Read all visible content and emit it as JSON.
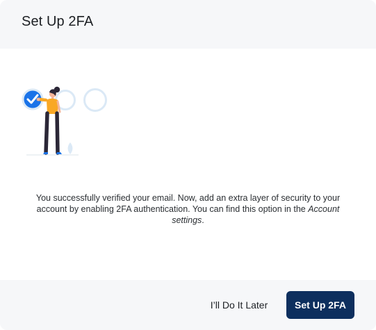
{
  "dialog": {
    "title": "Set Up 2FA",
    "message_prefix": "You successfully verified your email. Now, add an extra layer of security to your account by enabling 2FA authentication. You can find this option in the ",
    "message_link": "Account settings",
    "message_suffix": "."
  },
  "illustration": {
    "icon": "woman-checking-progress-steps-illustration",
    "steps_total": 3,
    "steps_completed": 1
  },
  "buttons": {
    "later_label": "I’ll Do It Later",
    "setup_label": "Set Up 2FA"
  },
  "colors": {
    "primary": "#0d2f5e",
    "accent": "#1a73e8",
    "header_bg": "#f6f7f9"
  }
}
